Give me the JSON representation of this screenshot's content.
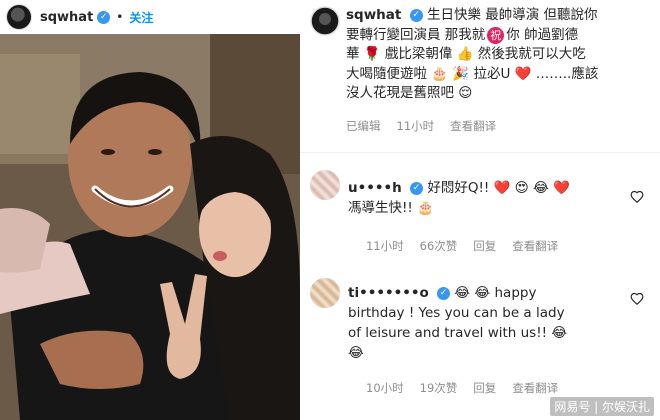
{
  "left": {
    "username": "sqwhat",
    "separator": "•",
    "follow_label": "关注"
  },
  "post": {
    "username": "sqwhat",
    "caption_line1": "生日快樂 最帥導演 但聽說你",
    "caption_line2": "要轉行變回演員 那我就",
    "caption_line2b": "祝",
    "caption_line2c": "你 帥過劉德",
    "caption_line3": "華 🌹 戲比梁朝偉 👍 然後我就可以大吃",
    "caption_line4": "大喝隨便遊啦 🎂 🎉 拉必U ❤️ ……..應該",
    "caption_line5": "沒人花現是舊照吧 😌",
    "edited": "已编辑",
    "time": "11小时",
    "translate": "查看翻译"
  },
  "comments": [
    {
      "name": "u••••h",
      "text_line1": "好悶好Q!! ❤️ 😍 😂 ❤️",
      "text_line2": "馮導生快!! 🎂",
      "time": "11小时",
      "likes": "66次赞",
      "reply": "回复",
      "translate": "查看翻译"
    },
    {
      "name": "ti•••••••o",
      "text_line1": "😂 😂 happy",
      "text_line2": "birthday ! Yes you can be a lady",
      "text_line3": "of leisure and travel with us!! 😂",
      "text_line4": "😂",
      "time": "10小时",
      "likes": "19次赞",
      "reply": "回复",
      "translate": "查看翻译"
    }
  ],
  "watermark": "网易号 | 尔娱沃扎",
  "colors": {
    "link": "#0095f6",
    "verified": "#3897f0",
    "meta": "#8e8e8e",
    "text": "#262626"
  }
}
